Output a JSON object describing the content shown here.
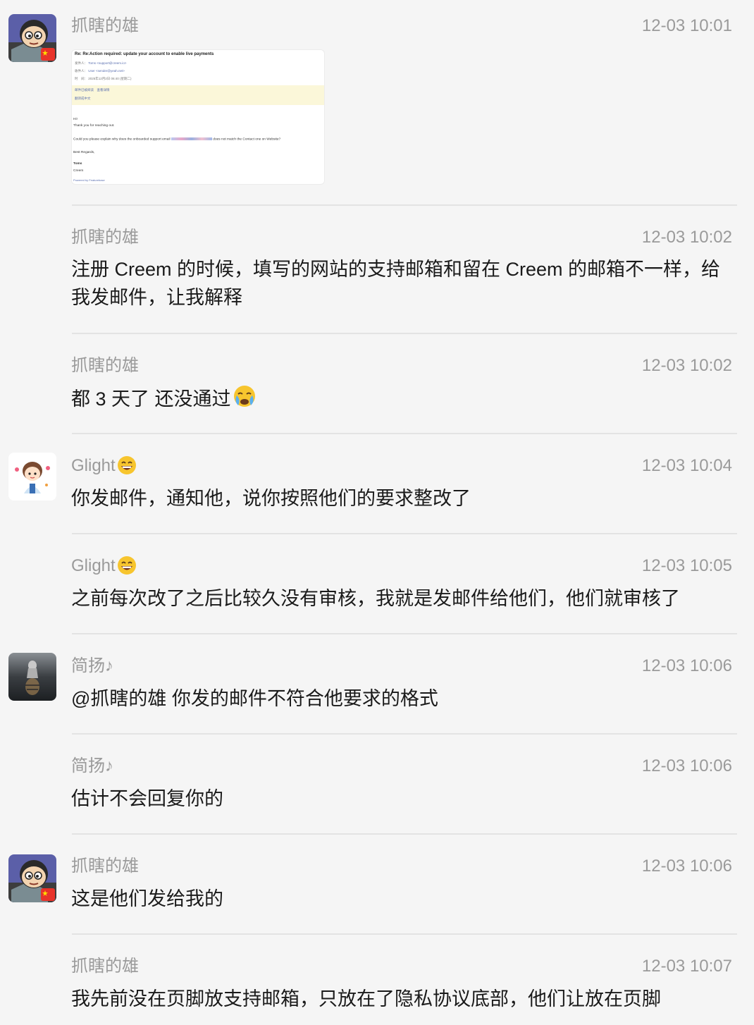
{
  "messages": [
    {
      "sender": "抓瞎的雄",
      "time": "12-03 10:01",
      "type": "image"
    },
    {
      "sender": "抓瞎的雄",
      "time": "12-03 10:02",
      "text": "注册 Creem 的时候，填写的网站的支持邮箱和留在 Creem 的邮箱不一样，给我发邮件，让我解释"
    },
    {
      "sender": "抓瞎的雄",
      "time": "12-03 10:02",
      "text": "都 3 天了 还没通过"
    },
    {
      "sender": "Glight",
      "time": "12-03 10:04",
      "text": "你发邮件，通知他，说你按照他们的要求整改了"
    },
    {
      "sender": "Glight",
      "time": "12-03 10:05",
      "text": "之前每次改了之后比较久没有审核，我就是发邮件给他们，他们就审核了"
    },
    {
      "sender": "简扬♪",
      "time": "12-03 10:06",
      "text": "@抓瞎的雄 你发的邮件不符合他要求的格式"
    },
    {
      "sender": "简扬♪",
      "time": "12-03 10:06",
      "text": "估计不会回复你的"
    },
    {
      "sender": "抓瞎的雄",
      "time": "12-03 10:06",
      "text": "这是他们发给我的"
    },
    {
      "sender": "抓瞎的雄",
      "time": "12-03 10:07",
      "text": "我先前没在页脚放支持邮箱，只放在了隐私协议底部，他们让放在页脚"
    }
  ],
  "email_image": {
    "subject": "Re: Re:Action required: update your account to enable live payments",
    "from_label": "发件人：",
    "from_value": "Toms <support@creem.io>",
    "to_label": "收件人：",
    "to_value": "User <sender@yeah.net>",
    "date_label": "时　间：",
    "date_value": "2025年12月2日 06:40 (星期二)",
    "band_line1": "邮件已被阅读　查看详情",
    "band_line2": "翻译成中文",
    "greeting": "Hi!",
    "line1": "Thank you for reaching out.",
    "line2a": "Could you please explain why does the onboarded support email",
    "line2b": "does not match the Contact one on Website?",
    "regards": "Best Regards,",
    "sign_name": "Toms",
    "sign_company": "Creem",
    "powered": "Powered by Featurebase"
  },
  "icons": {
    "emoji_grin": "grinning-face",
    "emoji_cry": "crying-face",
    "flag": "china-flag"
  }
}
